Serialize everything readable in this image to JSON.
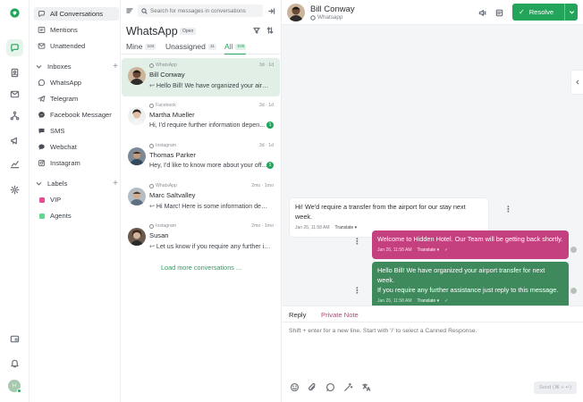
{
  "colors": {
    "brand": "#22a55b",
    "active_bg": "#e1efe7",
    "outgoing_pink": "#c5407e",
    "outgoing_green": "#3f8a5d",
    "incoming": "#ffffff",
    "label_vip": "#e64d93",
    "label_agents": "#5fd88f"
  },
  "sidebar": {
    "items": [
      {
        "label": "All Conversations",
        "icon": "chat-icon"
      },
      {
        "label": "Mentions",
        "icon": "at-icon"
      },
      {
        "label": "Unattended",
        "icon": "mail-icon"
      }
    ],
    "inboxes_title": "Inboxes",
    "inboxes": [
      {
        "label": "WhatsApp",
        "icon": "whatsapp-icon"
      },
      {
        "label": "Telegram",
        "icon": "telegram-icon"
      },
      {
        "label": "Facebook Messager",
        "icon": "messenger-icon"
      },
      {
        "label": "SMS",
        "icon": "sms-icon"
      },
      {
        "label": "Webchat",
        "icon": "chat-bubble-icon"
      },
      {
        "label": "Instagram",
        "icon": "instagram-icon"
      }
    ],
    "labels_title": "Labels",
    "labels": [
      {
        "label": "VIP"
      },
      {
        "label": "Agents"
      }
    ],
    "avatar_initial": "H"
  },
  "list": {
    "search_placeholder": "Search for messages in conversations",
    "title": "WhatsApp",
    "status": "Open",
    "tabs": [
      {
        "label": "Mine",
        "count": "104"
      },
      {
        "label": "Unassigned",
        "count": "11"
      },
      {
        "label": "All",
        "count": "536"
      }
    ],
    "conversations": [
      {
        "source": "WhatsApp",
        "name": "Bill Conway",
        "preview": "Hello Bill! We have organized your airport...",
        "time": "3d · 1d",
        "badge": ""
      },
      {
        "source": "Facebook",
        "name": "Martha Mueller",
        "preview": "Hi, I'd require further information depen...",
        "time": "3d · 1d",
        "badge": "1"
      },
      {
        "source": "Instagram",
        "name": "Thomas Parker",
        "preview": "Hey, I'd like to know more about your off...",
        "time": "3d · 1d",
        "badge": "1"
      },
      {
        "source": "WhatsApp",
        "name": "Marc Saltvalley",
        "preview": "Hi Marc! Here is some information depe...",
        "time": "2mo · 1mo",
        "badge": ""
      },
      {
        "source": "Instagram",
        "name": "Susan",
        "preview": "Let us know if you require any further inf...",
        "time": "2mo · 1mo",
        "badge": ""
      }
    ],
    "load_more": "Load more conversations ..."
  },
  "chat": {
    "name": "Bill Conway",
    "channel": "Whatsapp",
    "resolve": "Resolve",
    "messages": [
      {
        "text": "Hi! We'd require a transfer from the airport for our stay next week.",
        "time": "Jan 26, 11:58 AM",
        "translate": "Translate"
      },
      {
        "text": "Welcome to Hidden Hotel. Our Team will be getting back shortly.",
        "time": "Jan 26, 11:58 AM",
        "translate": "Translate"
      },
      {
        "line1": "Hello Bill! We have organized your airport transfer for next week.",
        "line2": "If you require any further assistance just reply to this message.",
        "time": "Jan 26, 11:58 AM",
        "translate": "Translate"
      }
    ],
    "composer": {
      "reply_tab": "Reply",
      "private_tab": "Private Note",
      "placeholder": "Shift + enter for a new line. Start with '/' to select a Canned Response.",
      "send": "Send (⌘ + ↵)"
    }
  }
}
